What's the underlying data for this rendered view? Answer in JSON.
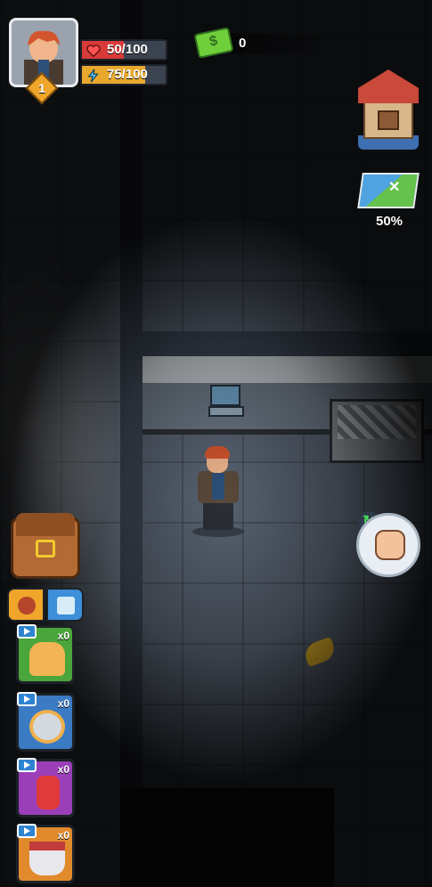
{
  "player": {
    "level": "1",
    "health": "50/100",
    "health_fraction": 0.5,
    "energy": "75/100",
    "energy_fraction": 0.75
  },
  "currency": {
    "money": "0"
  },
  "map": {
    "explored": "50%"
  },
  "inventory": {
    "tabs": [
      "food",
      "drink"
    ],
    "slots": [
      {
        "item": "bread",
        "count": "x0",
        "ad": "tv-icon"
      },
      {
        "item": "canned-food",
        "count": "x0",
        "ad": "tv-icon"
      },
      {
        "item": "soda-can",
        "count": "x0",
        "ad": "tv-icon"
      },
      {
        "item": "soup-bowl",
        "count": "x0",
        "ad": "tv-icon"
      }
    ]
  },
  "colors": {
    "health": "#d83a3a",
    "energy": "#e8a82d",
    "money": "#6fcf3a",
    "slot_green": "#4aa53a",
    "slot_blue": "#3b7bc4",
    "slot_purple": "#9a3fb8",
    "slot_orange": "#e18a2c"
  }
}
